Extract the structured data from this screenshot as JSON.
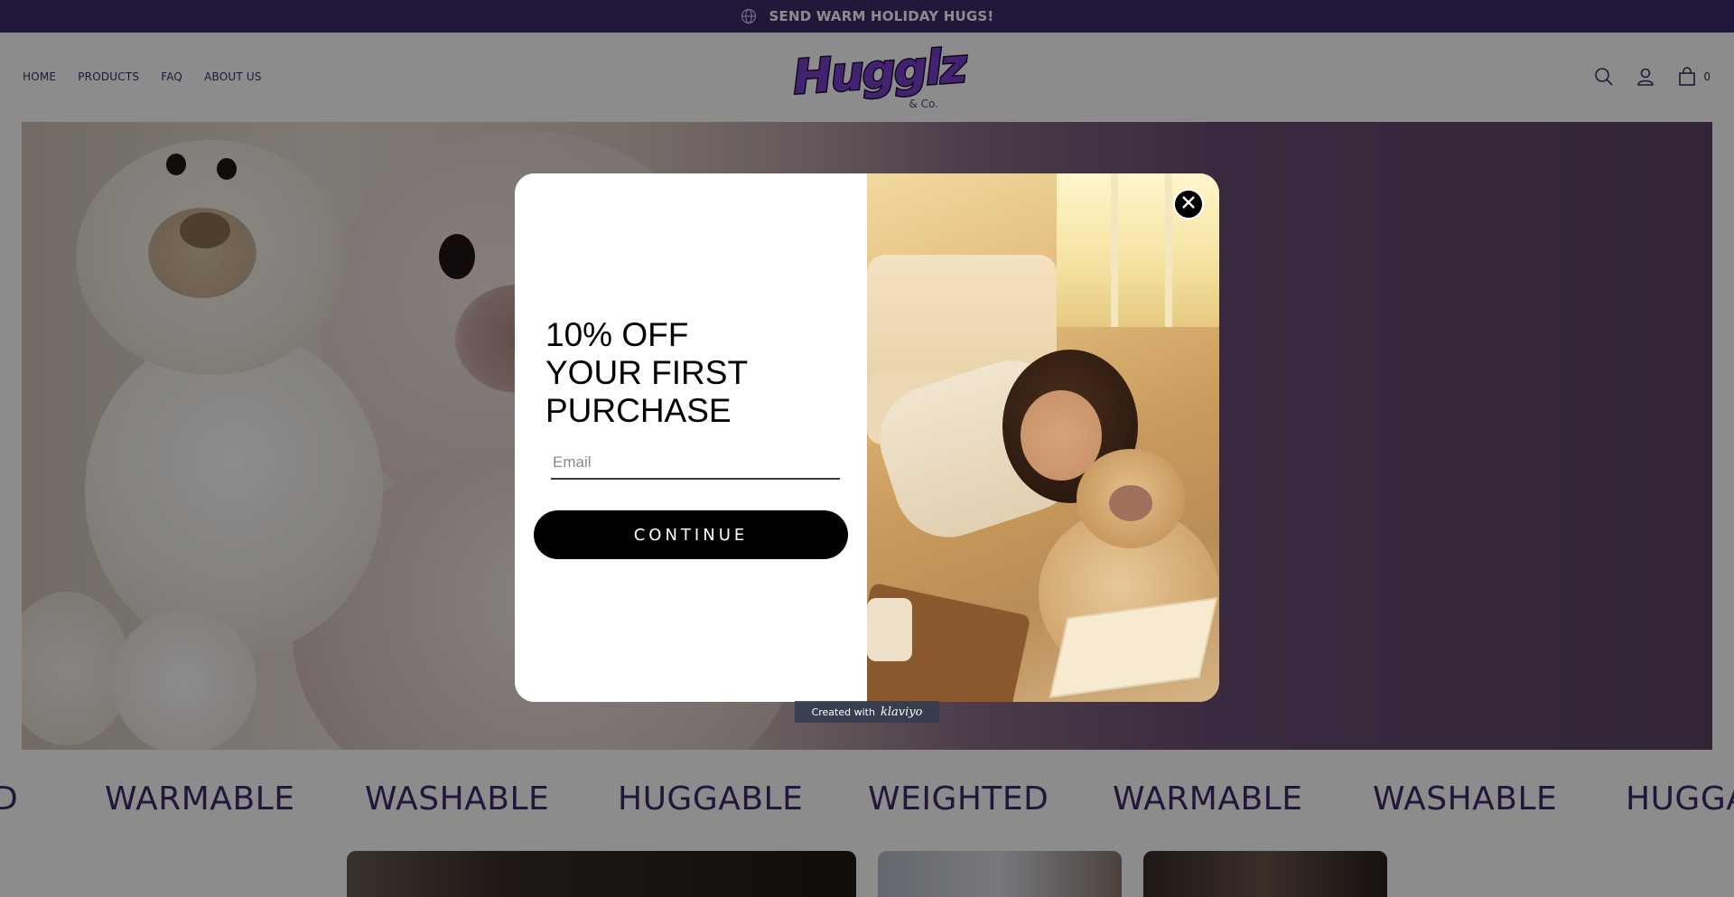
{
  "announcement": {
    "text": "SEND WARM HOLIDAY HUGS!",
    "icon": "globe-icon"
  },
  "nav": {
    "items": [
      {
        "label": "HOME"
      },
      {
        "label": "PRODUCTS"
      },
      {
        "label": "FAQ"
      },
      {
        "label": "ABOUT US"
      }
    ]
  },
  "logo": {
    "text": "Hugglz",
    "subtext": "& Co."
  },
  "header_icons": {
    "search": "search-icon",
    "account": "account-icon",
    "cart": "cart-icon",
    "cart_count": "0"
  },
  "marquee": {
    "words": [
      "D",
      "WARMABLE",
      "WASHABLE",
      "HUGGABLE",
      "WEIGHTED",
      "WARMABLE",
      "WASHABLE",
      "HUGGA"
    ]
  },
  "modal": {
    "headline": [
      "10% OFF",
      "YOUR FIRST",
      "PURCHASE"
    ],
    "email_placeholder": "Email",
    "continue_label": "CONTINUE",
    "close_icon": "close-icon",
    "created_with": "Created with",
    "brand": "klaviyo"
  },
  "colors": {
    "brand_purple": "#3f2a6b",
    "button_black": "#000000",
    "overlay": "rgba(0,0,0,0.45)"
  }
}
